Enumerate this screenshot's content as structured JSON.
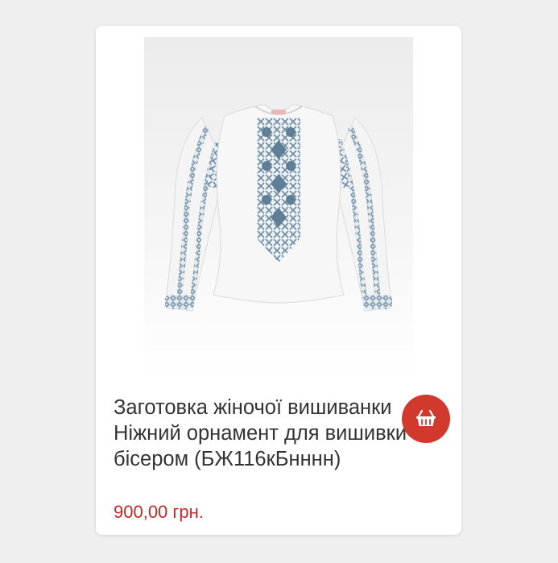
{
  "product": {
    "title": "Заготовка жіночої вишиванки Ніжний орнамент для вишивки бісером (БЖ116кБнннн)",
    "price": "900,00 грн.",
    "image_alt_icon": "embroidered-blouse-image",
    "cart_icon": "basket-icon"
  },
  "colors": {
    "price": "#c62828",
    "cart_button": "#d0392b",
    "embroidery": "#6a8aa0"
  }
}
